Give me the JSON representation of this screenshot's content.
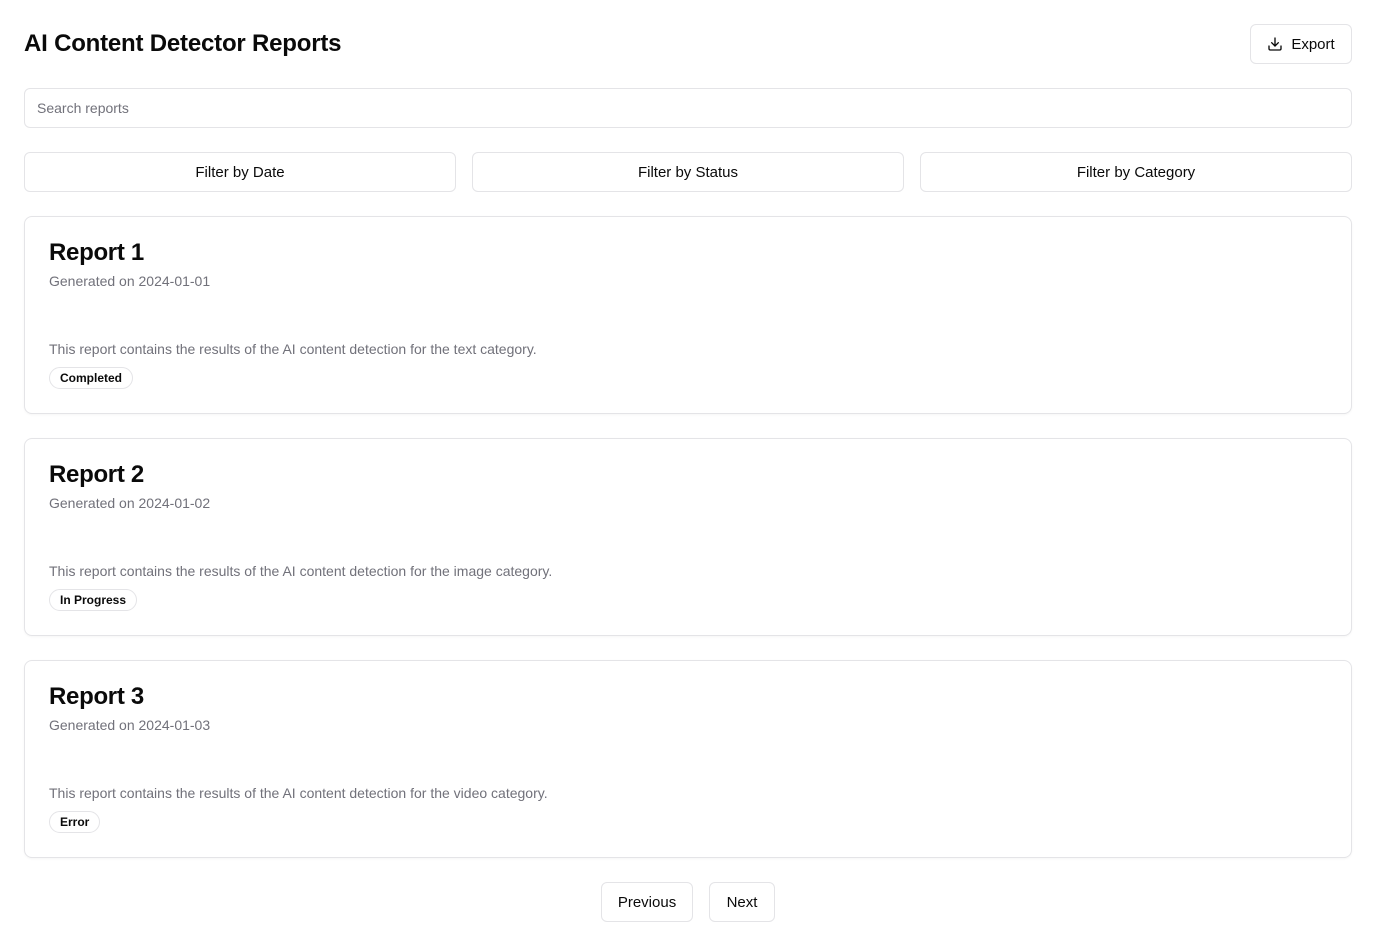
{
  "header": {
    "title": "AI Content Detector Reports",
    "export_label": "Export",
    "export_icon": "download-icon"
  },
  "search": {
    "placeholder": "Search reports",
    "value": ""
  },
  "filters": {
    "date_label": "Filter by Date",
    "status_label": "Filter by Status",
    "category_label": "Filter by Category"
  },
  "reports": [
    {
      "title": "Report 1",
      "date": "Generated on 2024-01-01",
      "description": "This report contains the results of the AI content detection for the text category.",
      "status": "Completed"
    },
    {
      "title": "Report 2",
      "date": "Generated on 2024-01-02",
      "description": "This report contains the results of the AI content detection for the image category.",
      "status": "In Progress"
    },
    {
      "title": "Report 3",
      "date": "Generated on 2024-01-03",
      "description": "This report contains the results of the AI content detection for the video category.",
      "status": "Error"
    }
  ],
  "pagination": {
    "previous_label": "Previous",
    "next_label": "Next"
  },
  "colors": {
    "text": "#0a0a0a",
    "muted": "#71717a",
    "border": "#e4e4e7",
    "background": "#ffffff"
  }
}
